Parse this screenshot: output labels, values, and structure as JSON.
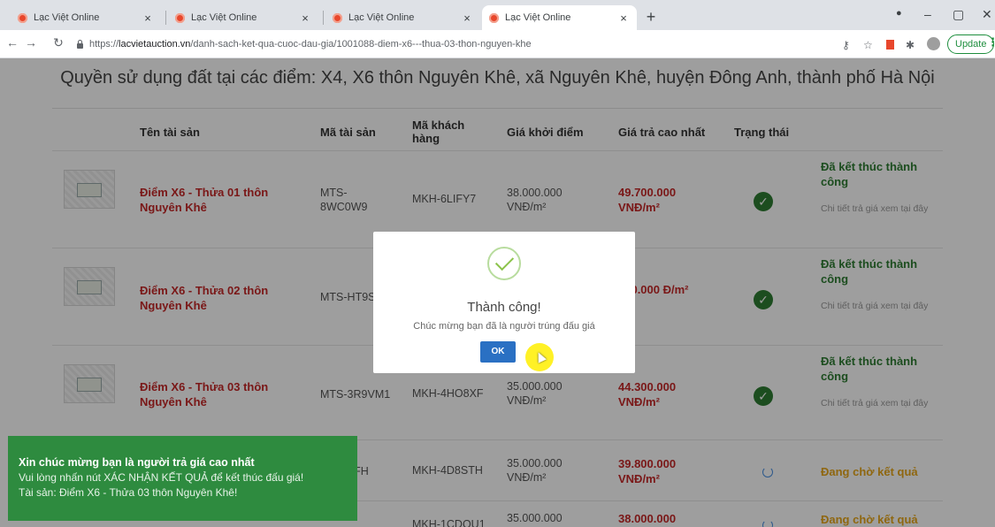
{
  "browser": {
    "tabs": [
      {
        "title": "Lạc Việt Online"
      },
      {
        "title": "Lạc Việt Online"
      },
      {
        "title": "Lạc Việt Online"
      },
      {
        "title": "Lạc Việt Online"
      }
    ],
    "tab_close": "×",
    "new_tab": "+",
    "url_prefix": "https://",
    "url_host": "lacvietauction.vn",
    "url_path": "/danh-sach-ket-qua-cuoc-dau-gia/1001088-diem-x6---thua-03-thon-nguyen-khe",
    "update_label": "Update",
    "icons": [
      "back-icon",
      "forward-icon",
      "reload-icon",
      "lock-icon",
      "key-icon",
      "star-icon",
      "extension-icon",
      "profile-icon",
      "menu-icon"
    ]
  },
  "page": {
    "title": "Quyền sử dụng đất tại các điểm: X4, X6 thôn Nguyên Khê, xã Nguyên Khê, huyện Đông Anh, thành phố Hà Nội",
    "columns": [
      "Tên tài sản",
      "Mã tài sản",
      "Mã khách hàng",
      "Giá khởi điểm",
      "Giá trả cao nhất",
      "Trạng thái"
    ],
    "rows": [
      {
        "name": "Điểm X6 - Thửa 01 thôn Nguyên Khê",
        "code": "MTS-8WC0W9",
        "customer": "MKH-6LIFY7",
        "start_price": "38.000.000 VNĐ/m²",
        "highest_price": "49.700.000 VNĐ/m²",
        "status": "Đã kết thúc thành công",
        "detail": "Chi tiết trả giá xem tại đây"
      },
      {
        "name": "Điểm X6 - Thửa 02 thôn Nguyên Khê",
        "code": "MTS-HT9S",
        "customer": "",
        "start_price": "",
        "highest_price": "500.000 Đ/m²",
        "status": "Đã kết thúc thành công",
        "detail": "Chi tiết trả giá xem tại đây"
      },
      {
        "name": "Điểm X6 - Thửa 03 thôn Nguyên Khê",
        "code": "MTS-3R9VM1",
        "customer": "MKH-4HO8XF",
        "start_price": "35.000.000 VNĐ/m²",
        "highest_price": "44.300.000 VNĐ/m²",
        "status": "Đã kết thúc thành công",
        "detail": "Chi tiết trả giá xem tại đây"
      },
      {
        "name": "",
        "code": "IRFFH",
        "customer": "MKH-4D8STH",
        "start_price": "35.000.000 VNĐ/m²",
        "highest_price": "39.800.000 VNĐ/m²",
        "status": "Đang chờ kết quả",
        "detail": ""
      },
      {
        "name": "",
        "code": "",
        "customer": "MKH-1CDQU1",
        "start_price": "35.000.000",
        "highest_price": "38.000.000",
        "status": "Đang chờ kết quả",
        "detail": ""
      }
    ]
  },
  "modal": {
    "title": "Thành công!",
    "message": "Chúc mừng bạn đã là người trúng đấu giá",
    "ok_label": "OK"
  },
  "toast": {
    "title": "Xin chúc mừng bạn là người trả giá cao nhất",
    "line1": "Vui lòng nhấn nút XÁC NHẬN KẾT QUẢ để kết thúc đấu giá!",
    "line2": "Tài sản: Điểm X6 - Thửa 03 thôn Nguyên Khê!"
  },
  "colors": {
    "accent_red": "#c62828",
    "success_green": "#2e7d32",
    "waiting_orange": "#e7a71a",
    "ok_blue": "#2a70c3",
    "toast_green": "#2e8b3f"
  }
}
